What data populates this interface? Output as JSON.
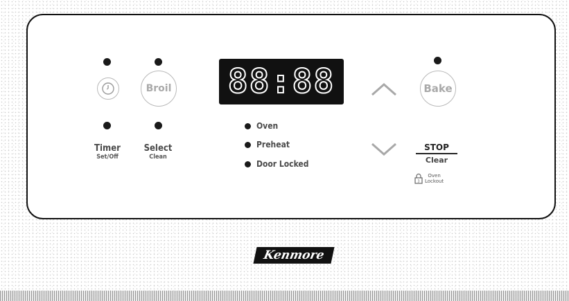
{
  "controls": {
    "timer": {
      "label": "Timer",
      "sub_label": "Set/Off"
    },
    "broil": {
      "button_label": "Broil"
    },
    "select": {
      "label": "Select",
      "sub_label": "Clean"
    },
    "display": {
      "value": "88:88"
    },
    "indicators": [
      {
        "label": "Oven"
      },
      {
        "label": "Preheat"
      },
      {
        "label": "Door Locked"
      }
    ],
    "bake": {
      "button_label": "Bake"
    },
    "stop": {
      "label": "STOP",
      "sub_label": "Clear"
    },
    "oven_lockout": {
      "line1": "Oven",
      "line2": "Lockout"
    }
  },
  "brand": {
    "logo_text": "Kenmore"
  },
  "icons": [
    "clock-icon",
    "up-arrow-icon",
    "down-arrow-icon",
    "lock-icon"
  ],
  "colors": {
    "panel_border": "#111111",
    "display_bg": "#111111",
    "indicator": "#1a1a1a"
  }
}
